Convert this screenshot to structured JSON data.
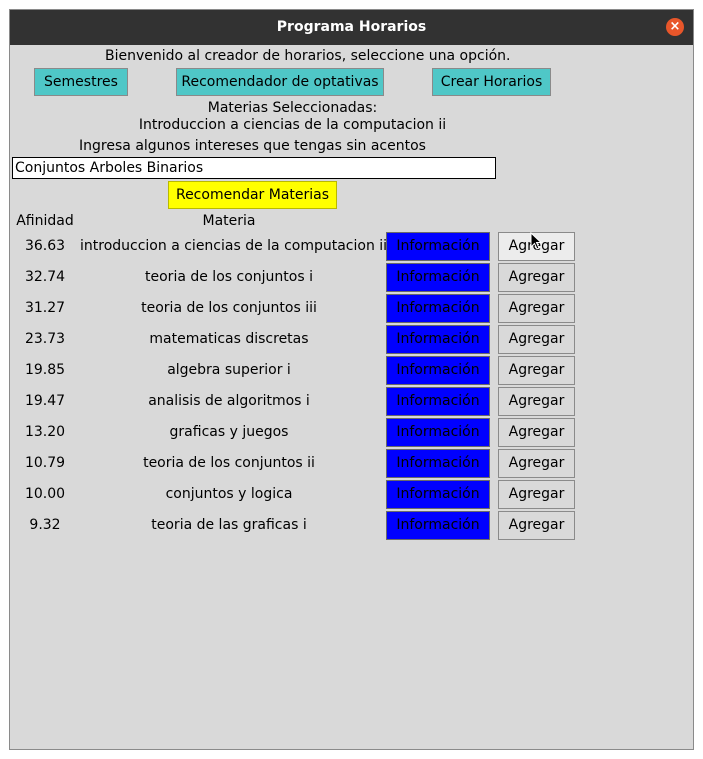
{
  "window": {
    "title": "Programa Horarios",
    "close_glyph": "×"
  },
  "welcome": "Bienvenido al creador de horarios, seleccione una opción.",
  "nav": {
    "semestres": "Semestres",
    "recomendador": "Recomendador de optativas",
    "crear": "Crear Horarios"
  },
  "selected": {
    "label": "Materias Seleccionadas:",
    "items": [
      "Introduccion a ciencias de la computacion ii"
    ]
  },
  "interests": {
    "label": "Ingresa algunos intereses que tengas sin acentos",
    "value": "Conjuntos Arboles Binarios",
    "recommend_button": "Recomendar Materias"
  },
  "table": {
    "headers": {
      "afinidad": "Afinidad",
      "materia": "Materia"
    },
    "info_label": "Información",
    "add_label": "Agregar",
    "rows": [
      {
        "afinidad": "36.63",
        "materia": "introduccion a ciencias de la computacion ii"
      },
      {
        "afinidad": "32.74",
        "materia": "teoria de los conjuntos i"
      },
      {
        "afinidad": "31.27",
        "materia": "teoria de los conjuntos iii"
      },
      {
        "afinidad": "23.73",
        "materia": "matematicas discretas"
      },
      {
        "afinidad": "19.85",
        "materia": "algebra superior i"
      },
      {
        "afinidad": "19.47",
        "materia": "analisis de algoritmos i"
      },
      {
        "afinidad": "13.20",
        "materia": "graficas y juegos"
      },
      {
        "afinidad": "10.79",
        "materia": "teoria de los conjuntos ii"
      },
      {
        "afinidad": "10.00",
        "materia": "conjuntos y logica"
      },
      {
        "afinidad": "9.32",
        "materia": "teoria de las graficas i"
      }
    ]
  },
  "colors": {
    "titlebar": "#323232",
    "window_bg": "#d9d9d9",
    "nav_button": "#4fc7c7",
    "recommend_button": "#ffff00",
    "info_button": "#0000ff",
    "close_button": "#e8562a"
  },
  "icons": {
    "close": "close-icon",
    "cursor": "mouse-pointer-icon"
  }
}
